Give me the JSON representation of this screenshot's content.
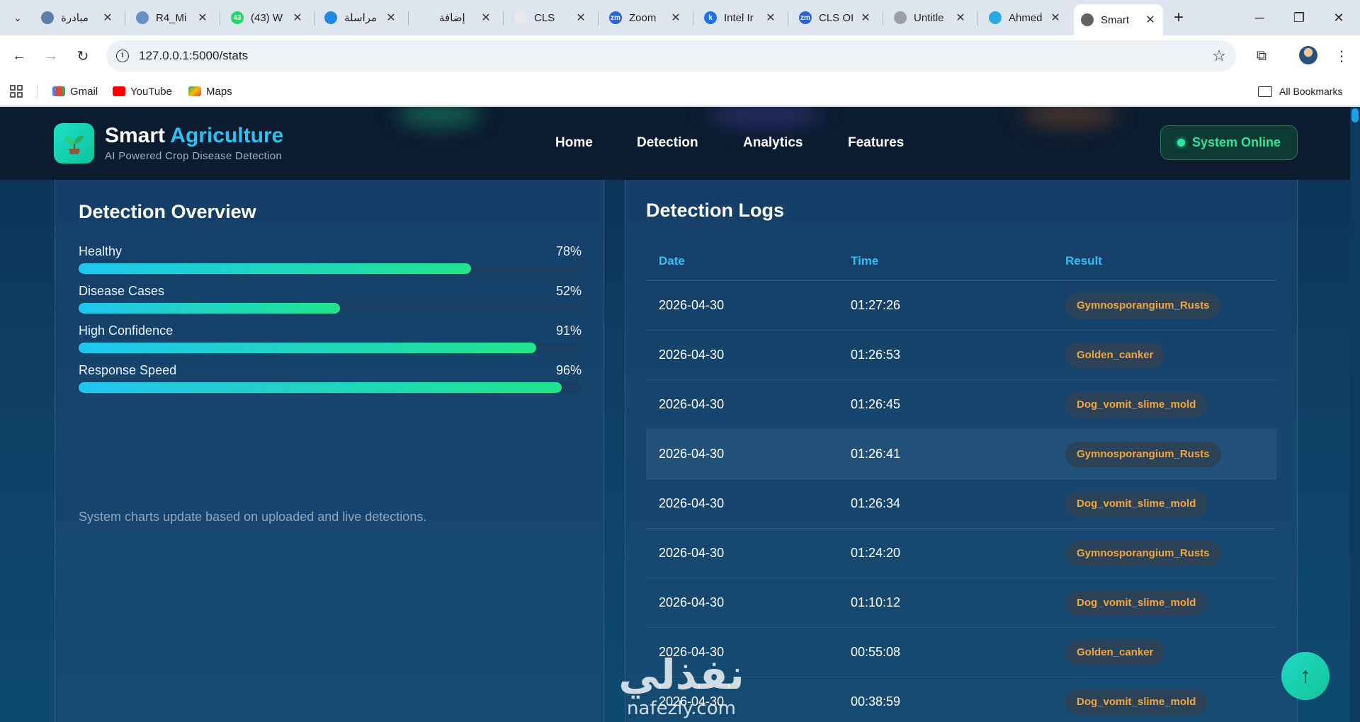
{
  "browser": {
    "tabs": [
      {
        "title": "مبادرة",
        "favicon_color": "#5a7fa8"
      },
      {
        "title": "R4_Mi",
        "favicon_color": "#6a8fc4"
      },
      {
        "title": "(43) W",
        "favicon_color": "#25d366",
        "favicon_text": "43"
      },
      {
        "title": "مراسلة",
        "favicon_color": "#1e88e5"
      },
      {
        "title": "إضافة",
        "favicon_color": "#dfe5ee"
      },
      {
        "title": "CLS",
        "favicon_color": "#e8eaed"
      },
      {
        "title": "Zoom",
        "favicon_color": "#2d62d4",
        "favicon_text": "zm"
      },
      {
        "title": "Intel Ir",
        "favicon_color": "#1a73e8",
        "favicon_text": "k"
      },
      {
        "title": "CLS OI",
        "favicon_color": "#2d62d4",
        "favicon_text": "zm"
      },
      {
        "title": "Untitle",
        "favicon_color": "#9aa0a6"
      },
      {
        "title": "Ahmed",
        "favicon_color": "#29a9e1"
      },
      {
        "title": "Smart",
        "favicon_color": "#5f6368"
      }
    ],
    "url": "127.0.0.1:5000/stats",
    "bookmarks": [
      {
        "label": "Gmail",
        "color": "#ea4335"
      },
      {
        "label": "YouTube",
        "color": "#ff0000"
      },
      {
        "label": "Maps",
        "color": "#34a853"
      }
    ],
    "all_bookmarks": "All Bookmarks"
  },
  "header": {
    "brand_main": "Smart",
    "brand_accent": "Agriculture",
    "tagline": "AI Powered Crop Disease Detection",
    "nav": [
      "Home",
      "Detection",
      "Analytics",
      "Features"
    ],
    "status": "System Online"
  },
  "overview": {
    "title": "Detection Overview",
    "metrics": [
      {
        "label": "Healthy",
        "percent_text": "78%",
        "value": 78
      },
      {
        "label": "Disease Cases",
        "percent_text": "52%",
        "value": 52
      },
      {
        "label": "High Confidence",
        "percent_text": "91%",
        "value": 91
      },
      {
        "label": "Response Speed",
        "percent_text": "96%",
        "value": 96
      }
    ],
    "note": "System charts update based on uploaded and live detections."
  },
  "logs": {
    "title": "Detection Logs",
    "columns": [
      "Date",
      "Time",
      "Result"
    ],
    "rows": [
      {
        "date": "2026-04-30",
        "time": "01:27:26",
        "result": "Gymnosporangium_Rusts"
      },
      {
        "date": "2026-04-30",
        "time": "01:26:53",
        "result": "Golden_canker"
      },
      {
        "date": "2026-04-30",
        "time": "01:26:45",
        "result": "Dog_vomit_slime_mold"
      },
      {
        "date": "2026-04-30",
        "time": "01:26:41",
        "result": "Gymnosporangium_Rusts"
      },
      {
        "date": "2026-04-30",
        "time": "01:26:34",
        "result": "Dog_vomit_slime_mold"
      },
      {
        "date": "2026-04-30",
        "time": "01:24:20",
        "result": "Gymnosporangium_Rusts"
      },
      {
        "date": "2026-04-30",
        "time": "01:10:12",
        "result": "Dog_vomit_slime_mold"
      },
      {
        "date": "2026-04-30",
        "time": "00:55:08",
        "result": "Golden_canker"
      },
      {
        "date": "2026-04-30",
        "time": "00:38:59",
        "result": "Dog_vomit_slime_mold"
      }
    ]
  },
  "watermark": {
    "arabic": "نفذلي",
    "latin": "nafezly.com"
  },
  "colors": {
    "accent": "#2dc2f5",
    "online": "#2ee59d",
    "badge_text": "#f0a640"
  }
}
